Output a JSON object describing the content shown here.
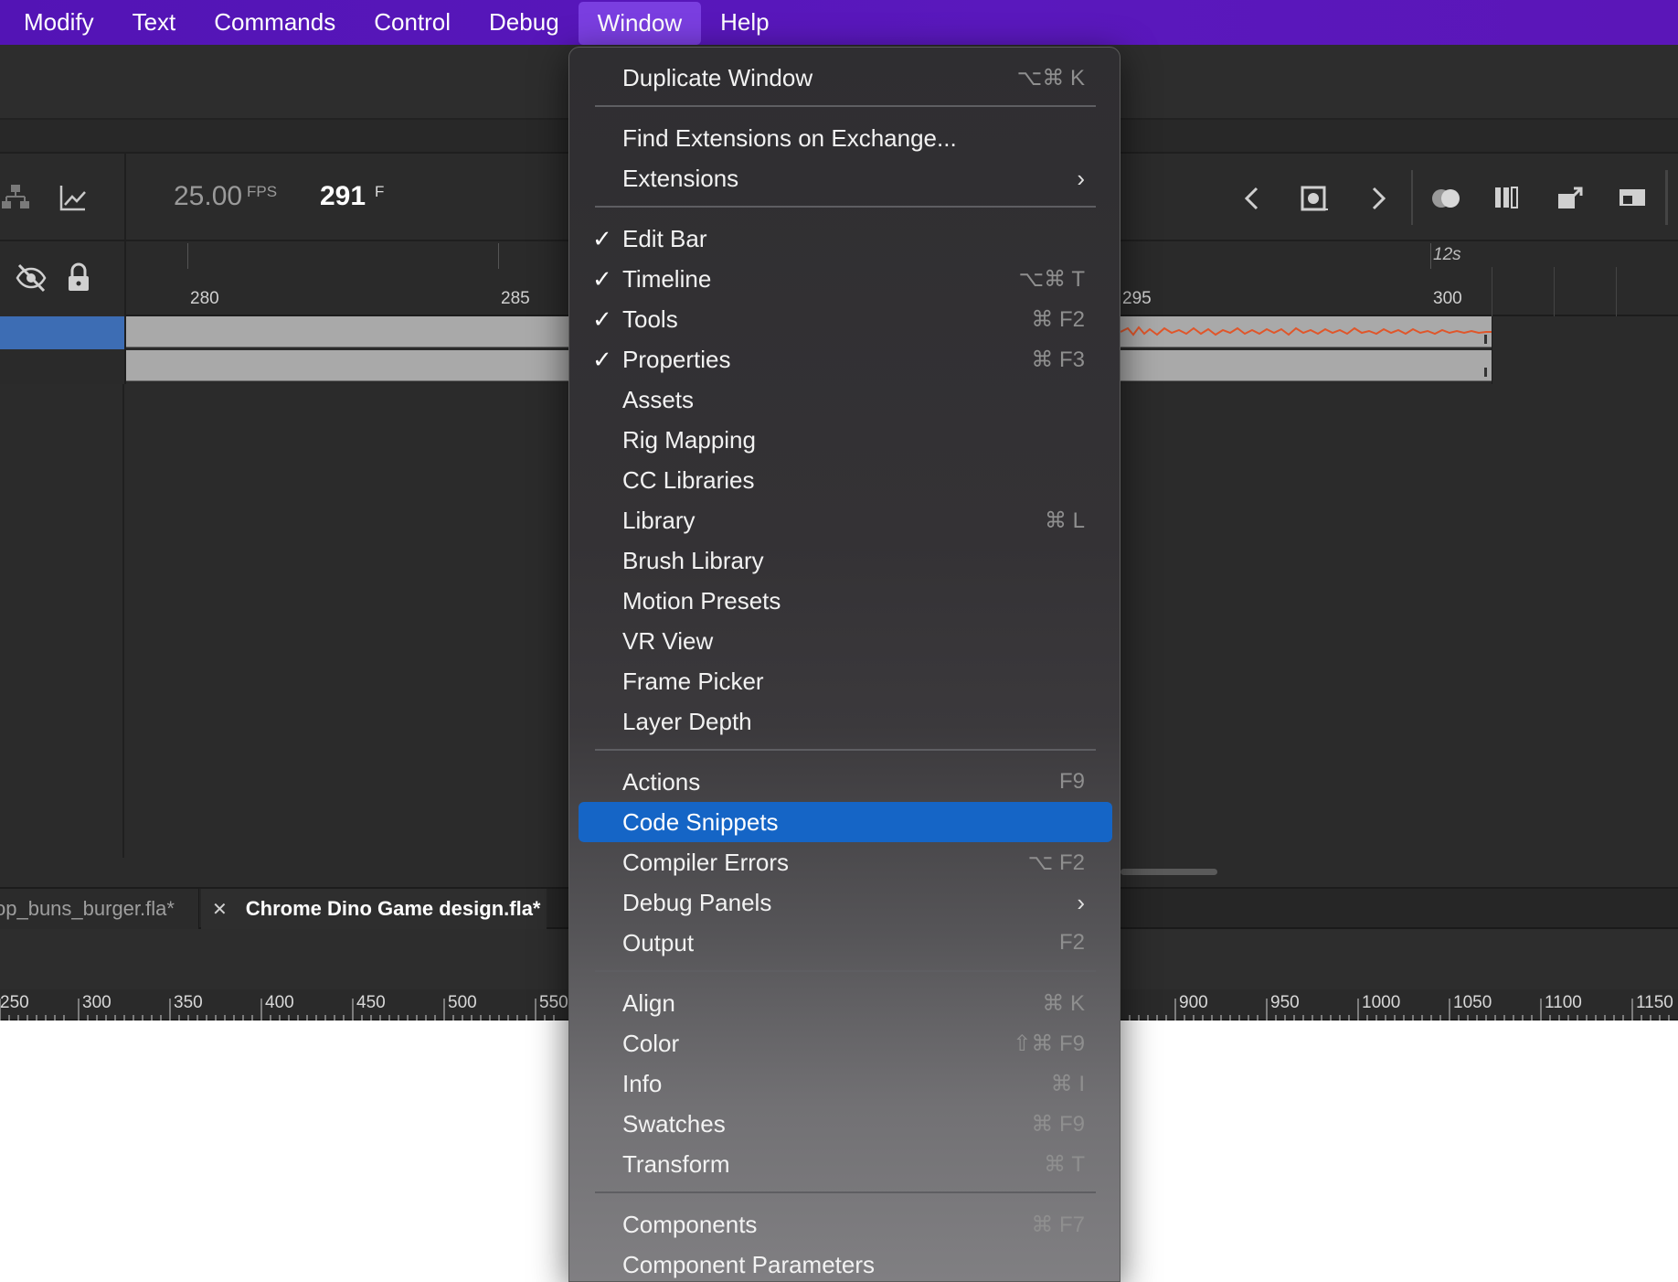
{
  "menubar": {
    "items": [
      "Modify",
      "Text",
      "Commands",
      "Control",
      "Debug",
      "Window",
      "Help"
    ],
    "active": "Window"
  },
  "timeline": {
    "fps_value": "25.00",
    "fps_unit": "FPS",
    "frame_value": "291",
    "frame_unit": "F",
    "ruler_labels": [
      "280",
      "285",
      "295",
      "300"
    ],
    "time_label": "12s",
    "waveform_color": "#e0562a",
    "selected_layer_color": "#3d6db4"
  },
  "tabs": {
    "tab1": "op_buns_burger.fla*",
    "close_symbol": "✕",
    "tab2": "Chrome Dino Game design.fla*"
  },
  "stage_ruler": [
    "250",
    "300",
    "350",
    "400",
    "450",
    "500",
    "550",
    "900",
    "950",
    "1000",
    "1050",
    "1100",
    "1150"
  ],
  "window_menu": {
    "items": [
      {
        "label": "Duplicate Window",
        "shortcut": "⌥⌘ K"
      },
      {
        "label": "Find Extensions on Exchange..."
      },
      {
        "label": "Extensions",
        "submenu": "›"
      },
      {
        "label": "Edit Bar",
        "check": "✓"
      },
      {
        "label": "Timeline",
        "check": "✓",
        "shortcut": "⌥⌘ T"
      },
      {
        "label": "Tools",
        "check": "✓",
        "shortcut": "⌘ F2"
      },
      {
        "label": "Properties",
        "check": "✓",
        "shortcut": "⌘ F3"
      },
      {
        "label": "Assets"
      },
      {
        "label": "Rig Mapping"
      },
      {
        "label": "CC Libraries"
      },
      {
        "label": "Library",
        "shortcut": "⌘ L"
      },
      {
        "label": "Brush Library"
      },
      {
        "label": "Motion Presets"
      },
      {
        "label": "VR View"
      },
      {
        "label": "Frame Picker"
      },
      {
        "label": "Layer Depth"
      },
      {
        "label": "Actions",
        "shortcut": "F9"
      },
      {
        "label": "Code Snippets",
        "highlighted": true
      },
      {
        "label": "Compiler Errors",
        "shortcut": "⌥ F2"
      },
      {
        "label": "Debug Panels",
        "submenu": "›"
      },
      {
        "label": "Output",
        "shortcut": "F2"
      },
      {
        "label": "Align",
        "shortcut": "⌘ K"
      },
      {
        "label": "Color",
        "shortcut": "⇧⌘ F9"
      },
      {
        "label": "Info",
        "shortcut": "⌘ I"
      },
      {
        "label": "Swatches",
        "shortcut": "⌘ F9"
      },
      {
        "label": "Transform",
        "shortcut": "⌘ T"
      },
      {
        "label": "Components",
        "shortcut": "⌘ F7"
      },
      {
        "label": "Component Parameters"
      }
    ],
    "highlight_color": "#1565c6"
  },
  "icons": [
    "hierarchy-icon",
    "graph-icon",
    "visibility-off-icon",
    "lock-icon",
    "prev-keyframe-icon",
    "insert-keyframe-icon",
    "next-keyframe-icon",
    "onion-skin-icon",
    "frame-view-icon",
    "export-icon",
    "panel-icon"
  ]
}
